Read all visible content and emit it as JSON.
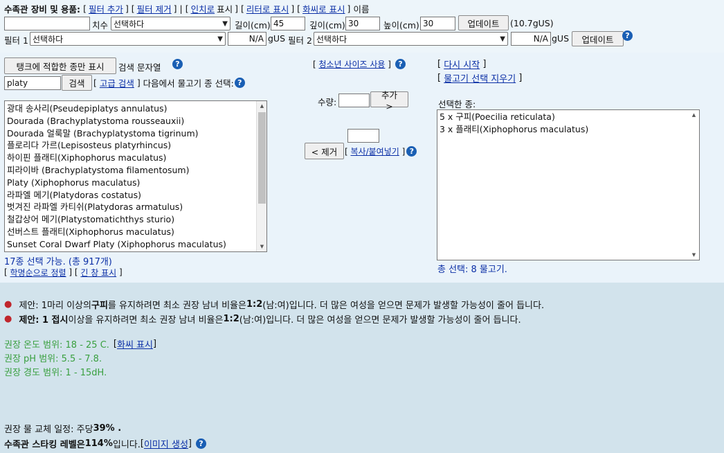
{
  "header": {
    "title": "수족관 장비 및 용품:",
    "add_filter": "필터 추가",
    "remove_filter": "필터 제거",
    "inch": "인치로",
    "display": "표시",
    "liter_display": "리터로 표시",
    "fahrenheit_display": "화씨로 표시",
    "name": "이름"
  },
  "dimensions": {
    "name_value": "",
    "dim_label": "치수",
    "dim_select": "선택하다",
    "length_label": "길이(cm)",
    "length_value": "45",
    "depth_label": "깊이(cm)",
    "depth_value": "30",
    "height_label": "높이(cm)",
    "height_value": "30",
    "update_label": "업데이트",
    "volume": "(10.7gUS)"
  },
  "filters": {
    "filter1_label": "필터 1",
    "filter1_select": "선택하다",
    "filter1_value": "N/A",
    "unit1": "gUS",
    "filter2_label": "필터 2",
    "filter2_select": "선택하다",
    "filter2_value": "N/A",
    "unit2": "gUS",
    "update_label": "업데이트"
  },
  "search": {
    "show_fit_label": "탱크에 적합한 종만 표시",
    "search_string_label": "검색 문자열",
    "query": "platy",
    "search_button": "검색",
    "advanced": "고급 검색",
    "select_from": "다음에서 물고기 종 선택:"
  },
  "species_list": [
    "광대 송사리(Pseudepiplatys annulatus)",
    "Dourada (Brachyplatystoma rousseauxii)",
    "Dourada 얼룩말 (Brachyplatystoma tigrinum)",
    "플로리다 가르(Lepisosteus platyrhincus)",
    "하이핀 플래티(Xiphophorus maculatus)",
    "피라이바 (Brachyplatystoma filamentosum)",
    "Platy (Xiphophorus maculatus)",
    "라파엘 메기(Platydoras costatus)",
    "벗겨진 라파엘 카티쉬(Platydoras armatulus)",
    "철갑상어 메기(Platystomatichthys sturio)",
    "선버스트 플래티(Xiphophorus maculatus)",
    "Sunset Coral Dwarf Platy (Xiphophorus maculatus)"
  ],
  "list_info": {
    "available": "17종 선택 가능. (총 917개)",
    "sort_scientific": "학명순으로 정렬",
    "long_window": "긴 창 표시"
  },
  "center": {
    "juvenile_size": "청소년 사이즈 사용",
    "quantity_label": "수량:",
    "quantity_value": "",
    "add_button": "추가 >",
    "remove_qty_value": "",
    "remove_button": "< 제거",
    "copy_paste": "복사/붙여넣기"
  },
  "right": {
    "restart": "다시 시작",
    "clear_selection": "물고기 선택 지우기",
    "selected_label": "선택한 종:",
    "selected_items": [
      "5 x 구피(Poecilia reticulata)",
      "3 x 플래티(Xiphophorus maculatus)"
    ],
    "total": "총 선택: 8 물고기."
  },
  "warnings": {
    "w1_a": "제안: 1마리 이상의 ",
    "w1_bold": "구피",
    "w1_b": " 를 유지하려면 최소 권장 남녀 비율은 ",
    "w1_ratio": "1:2",
    "w1_c": " (남:여)입니다. 더 많은 여성을 얻으면 문제가 발생할 가능성이 줄어 듭니다.",
    "w2_bold_a": "제안: 1 접시",
    "w2_a": " 이상을 유지하려면 최소 권장 남녀 비율은 ",
    "w2_ratio": "1:2",
    "w2_c": " (남:여)입니다. 더 많은 여성을 얻으면 문제가 발생할 가능성이 줄어 듭니다."
  },
  "ranges": {
    "temp": "권장 온도 범위: 18 - 25 C.",
    "fahrenheit_link": "화씨 표시",
    "ph": "권장 pH 범위: 5.5 - 7.8.",
    "hardness": "권장 경도 범위: 1 - 15dH."
  },
  "summary": {
    "water_change_a": "권장 물 교체 일정: 주당 ",
    "water_change_pct": "39% .",
    "stocking_a": "수족관 스타킹 레벨은 ",
    "stocking_pct": "114%",
    "stocking_b": " 입니다. ",
    "image_gen": "이미지 생성"
  },
  "colors": {
    "link": "#0b2fa6",
    "warning_bullet": "#c0262c",
    "range_green": "#3aa040",
    "help_icon": "#1a5fb4"
  }
}
